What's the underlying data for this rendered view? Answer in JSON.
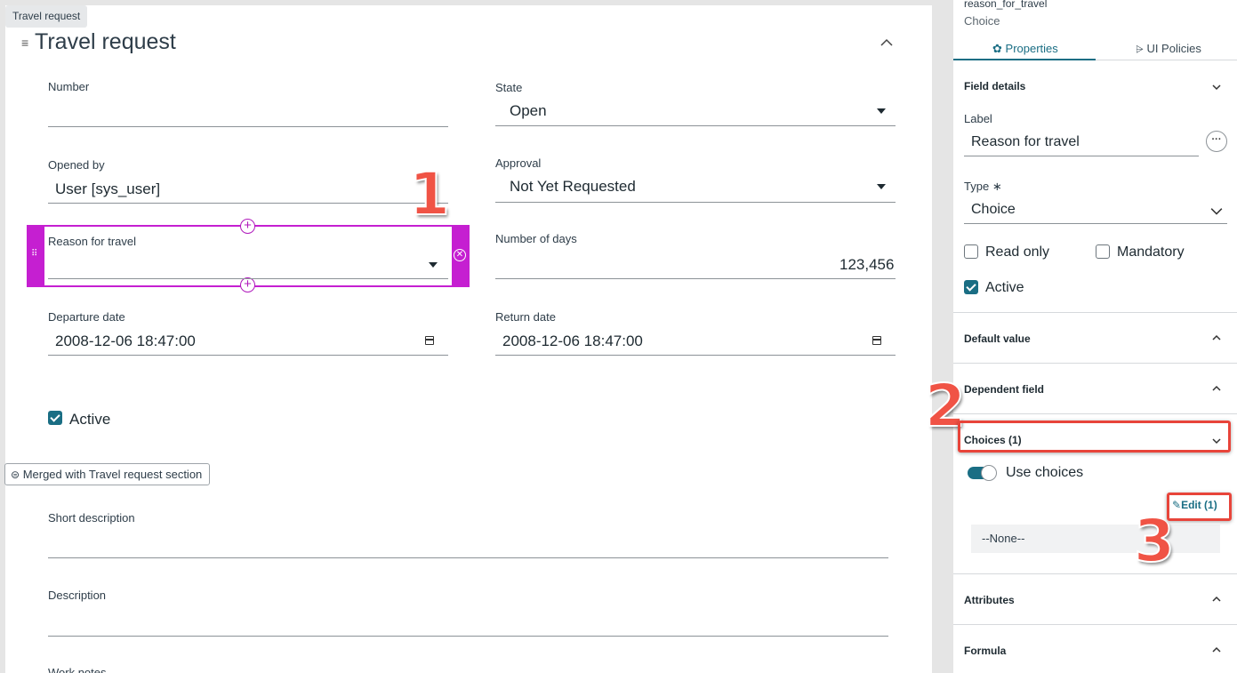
{
  "crumb": "Travel request",
  "form": {
    "title": "Travel request",
    "number": {
      "label": "Number",
      "value": ""
    },
    "state": {
      "label": "State",
      "value": "Open"
    },
    "opened_by": {
      "label": "Opened by",
      "value": "User [sys_user]"
    },
    "approval": {
      "label": "Approval",
      "value": "Not Yet Requested"
    },
    "reason": {
      "label": "Reason for travel",
      "value": ""
    },
    "number_of_days": {
      "label": "Number of days",
      "value": "123,456"
    },
    "departure": {
      "label": "Departure date",
      "value": "2008-12-06 18:47:00"
    },
    "return": {
      "label": "Return date",
      "value": "2008-12-06 18:47:00"
    },
    "active": {
      "label": "Active",
      "checked": true
    },
    "merged_tag": "Merged with Travel request section",
    "short_description": {
      "label": "Short description"
    },
    "description": {
      "label": "Description"
    },
    "work_notes": {
      "label": "Work notes"
    }
  },
  "annotations": {
    "one": "1",
    "two": "2",
    "three": "3",
    "color": "#f05345"
  },
  "panel": {
    "field_name": "reason_for_travel",
    "field_type": "Choice",
    "tabs": {
      "properties": "Properties",
      "ui_policies": "UI Policies"
    },
    "sections": {
      "field_details": "Field details",
      "default_value": "Default value",
      "dependent_field": "Dependent field",
      "choices": "Choices (1)",
      "attributes": "Attributes",
      "formula": "Formula"
    },
    "label": {
      "label": "Label",
      "value": "Reason for travel"
    },
    "type": {
      "label": "Type",
      "required_mark": "∗",
      "value": "Choice"
    },
    "read_only": {
      "label": "Read only",
      "checked": false
    },
    "mandatory": {
      "label": "Mandatory",
      "checked": false
    },
    "active": {
      "label": "Active",
      "checked": true
    },
    "use_choices": {
      "label": "Use choices",
      "on": true
    },
    "edit_button": "Edit (1)",
    "none_option": "--None--",
    "accent": "#1a6e84"
  }
}
